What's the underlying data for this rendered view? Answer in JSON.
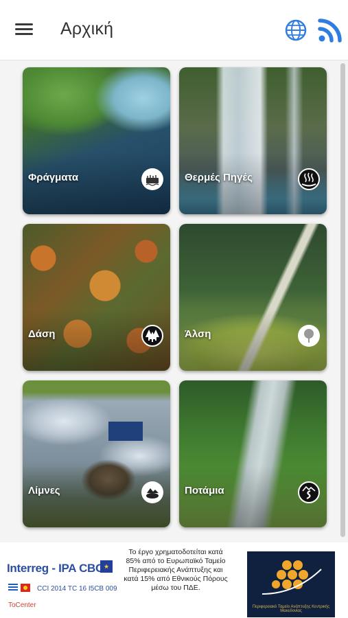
{
  "header": {
    "title": "Αρχική",
    "menu_icon": "hamburger-menu-icon",
    "language_icon": "globe-icon",
    "feed_icon": "rss-feed-icon",
    "accent_color": "#2f7de1"
  },
  "categories": [
    {
      "label": "Φράγματα",
      "icon": "dam-icon",
      "badge_style": "light"
    },
    {
      "label": "Θερμές Πηγές",
      "icon": "hot-spring-icon",
      "badge_style": "dark"
    },
    {
      "label": "Δάση",
      "icon": "forest-icon",
      "badge_style": "dark"
    },
    {
      "label": "Άλση",
      "icon": "tree-icon",
      "badge_style": "light"
    },
    {
      "label": "Λίμνες",
      "icon": "lake-icon",
      "badge_style": "light"
    },
    {
      "label": "Ποτάμια",
      "icon": "river-icon",
      "badge_style": "dark"
    }
  ],
  "footer": {
    "program_name": "Interreg - IPA CBC",
    "program_code": "CCI 2014 TC 16 I5CB 009",
    "project_name": "ToCenter",
    "funding_text": "Το έργο χρηματοδοτείται κατά 85% από το Ευρωπαϊκό Ταμείο Περιφερειακής Ανάπτυξης και κατά 15% από Εθνικούς Πόρους μέσω του ΠΔΕ.",
    "region_logo_caption": "Περιφερειακό Ταμείο Ανάπτυξης Κεντρικής Μακεδονίας"
  }
}
